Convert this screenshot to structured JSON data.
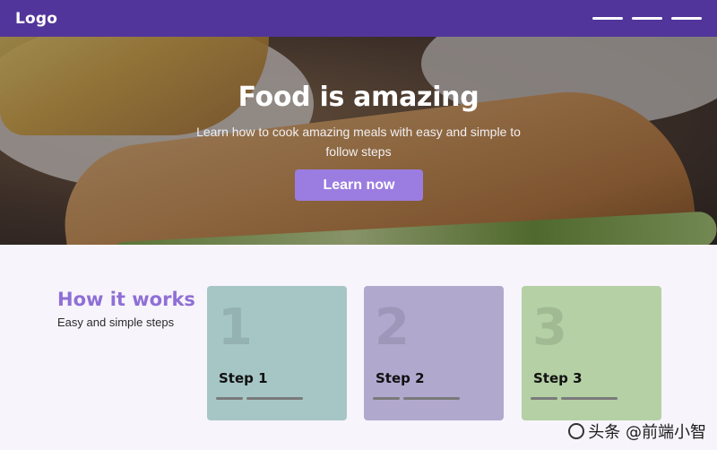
{
  "nav": {
    "logo": "Logo",
    "menu_icon": "hamburger-menu-icon"
  },
  "hero": {
    "title": "Food is amazing",
    "subtitle": "Learn how to cook amazing meals with easy and simple to follow steps",
    "cta_label": "Learn now"
  },
  "how": {
    "title": "How it works",
    "subtitle": "Easy and simple steps",
    "cards": [
      {
        "number": "1",
        "label": "Step 1",
        "color": "#a6c6c6"
      },
      {
        "number": "2",
        "label": "Step 2",
        "color": "#b1a8ce"
      },
      {
        "number": "3",
        "label": "Step 3",
        "color": "#b4d0a4"
      }
    ]
  },
  "watermark": {
    "text": "头条 @前端小智"
  },
  "colors": {
    "nav": "#52359b",
    "accent": "#9b7ce0",
    "heading": "#8f6fd6"
  }
}
